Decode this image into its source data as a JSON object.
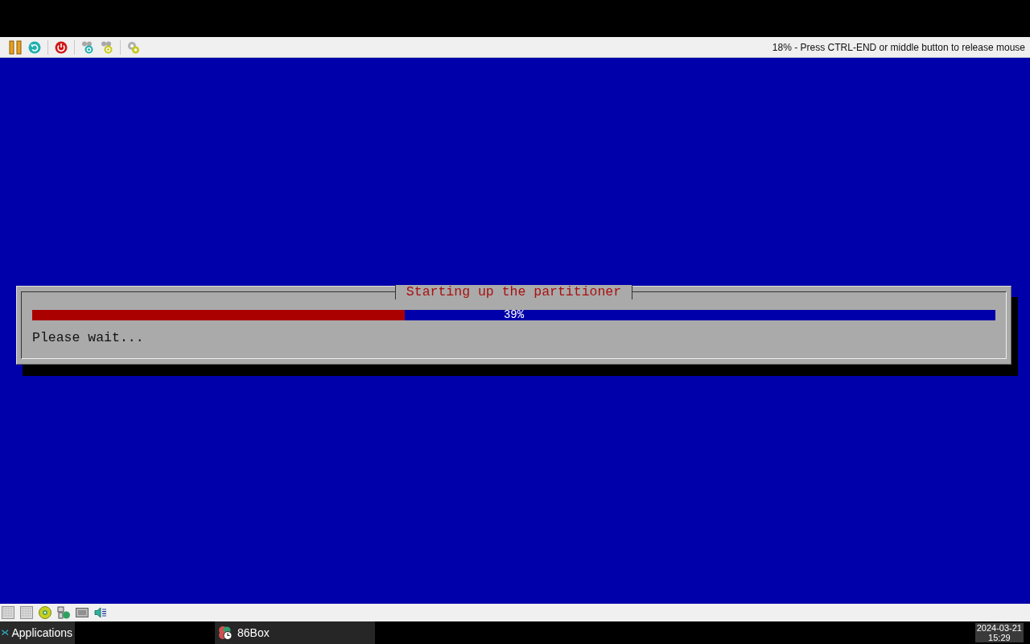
{
  "toolbar": {
    "status_text": "18% - Press CTRL-END or middle button to release mouse"
  },
  "installer": {
    "dialog": {
      "title": "Starting up the partitioner",
      "progress": {
        "level": 0.387,
        "reading": "39%"
      },
      "message": "Please wait..."
    }
  },
  "taskbar": {
    "menu_button": "Applications",
    "tasks": [
      {
        "label": "86Box",
        "selected": false
      }
    ],
    "clock": {
      "date": "2024-03-21",
      "time": "15:29"
    }
  }
}
